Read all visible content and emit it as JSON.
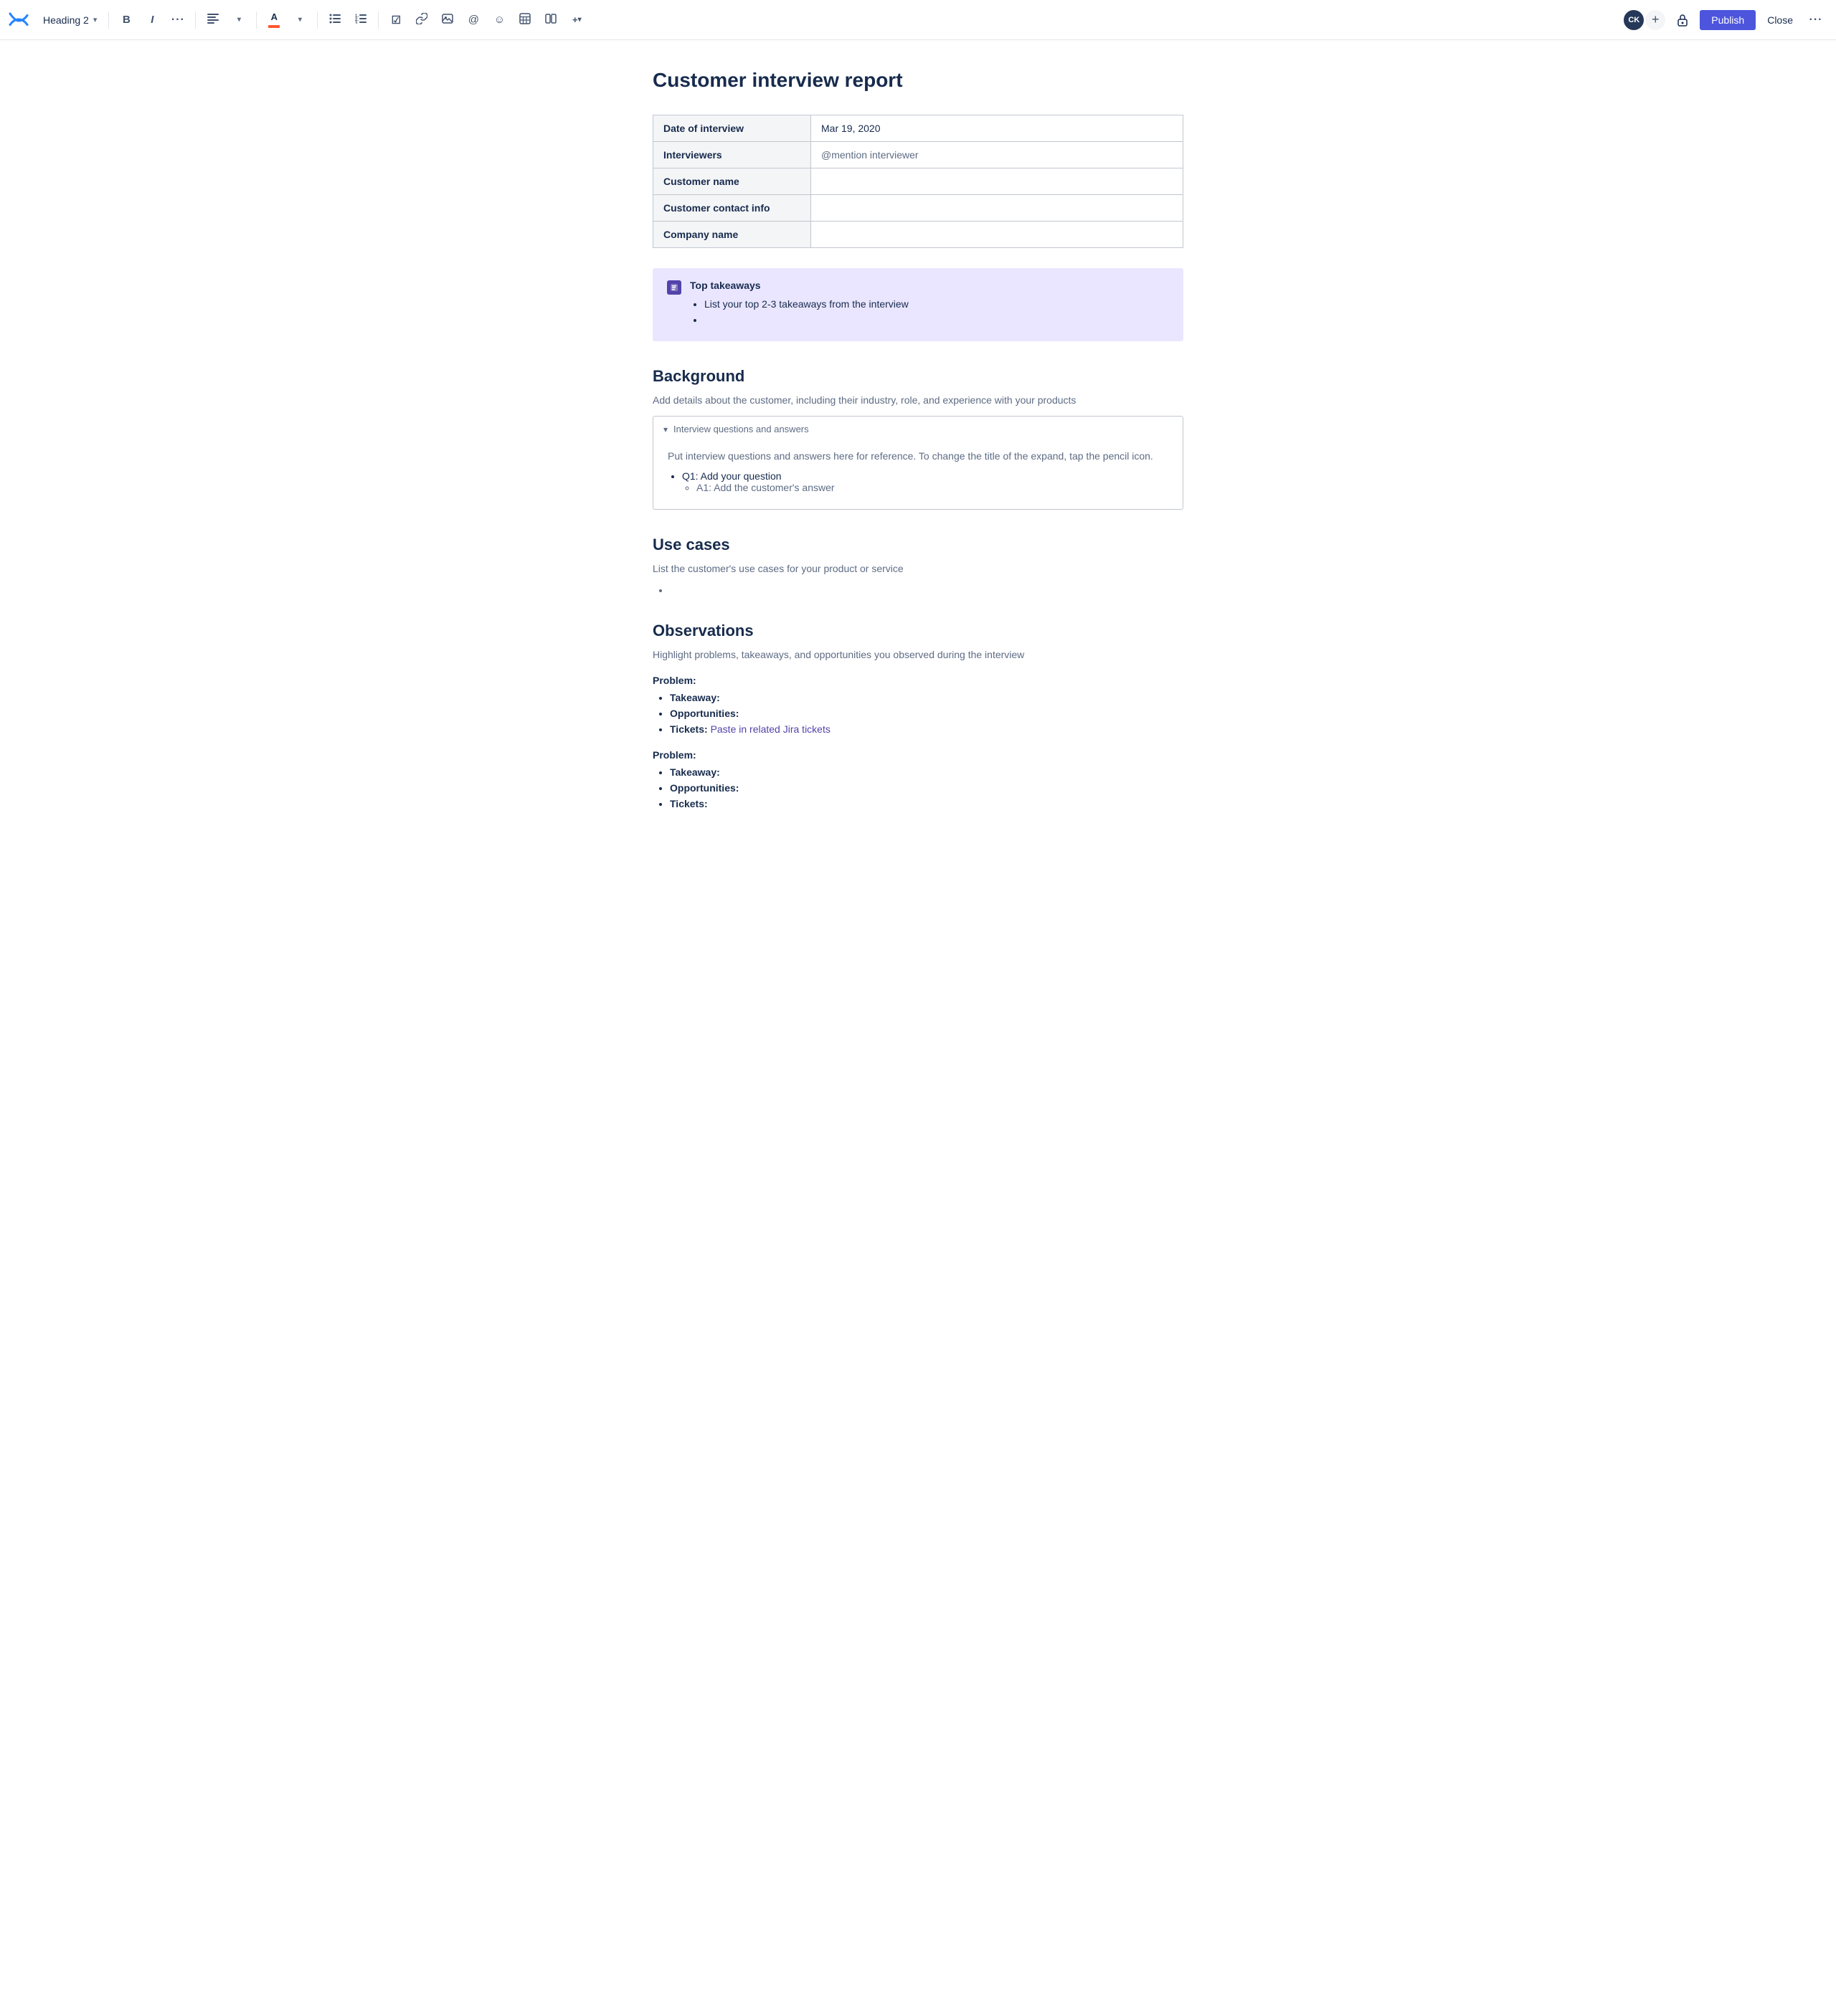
{
  "toolbar": {
    "logo_label": "Confluence",
    "heading_label": "Heading 2",
    "bold_label": "B",
    "italic_label": "I",
    "more_label": "···",
    "align_label": "≡",
    "bullet_list_label": "≡",
    "numbered_list_label": "≡",
    "task_label": "☑",
    "link_label": "🔗",
    "image_label": "🖼",
    "mention_label": "@",
    "emoji_label": "☺",
    "table_label": "▦",
    "layout_label": "⊟",
    "more_insert_label": "+",
    "avatar_initials": "CK",
    "avatar_bg": "#253858",
    "add_label": "+",
    "lock_label": "🔒",
    "publish_label": "Publish",
    "close_label": "Close",
    "more_options_label": "···"
  },
  "document": {
    "title": "Customer interview report",
    "info_table": {
      "rows": [
        {
          "label": "Date of interview",
          "value": "Mar 19, 2020"
        },
        {
          "label": "Interviewers",
          "value": "@mention interviewer"
        },
        {
          "label": "Customer name",
          "value": ""
        },
        {
          "label": "Customer contact info",
          "value": ""
        },
        {
          "label": "Company name",
          "value": ""
        }
      ]
    },
    "callout": {
      "title": "Top takeaways",
      "items": [
        "List your top 2-3 takeaways from the interview",
        ""
      ]
    },
    "sections": [
      {
        "heading": "Background",
        "subtext": "Add details about the customer, including their industry, role, and experience with your products",
        "expand": {
          "title": "Interview questions and answers",
          "body": "Put interview questions and answers here for reference. To change the title of the expand, tap the pencil icon.",
          "items": [
            {
              "text": "Q1: Add your question",
              "subitems": [
                "A1: Add the customer's answer"
              ]
            }
          ]
        }
      },
      {
        "heading": "Use cases",
        "subtext": "List the customer's use cases for your product or service",
        "bullets": [
          ""
        ]
      },
      {
        "heading": "Observations",
        "subtext": "Highlight problems, takeaways, and opportunities you observed during the interview",
        "problems": [
          {
            "label": "Problem:",
            "items": [
              {
                "prefix": "Takeaway:",
                "value": ""
              },
              {
                "prefix": "Opportunities:",
                "value": ""
              },
              {
                "prefix": "Tickets:",
                "value": "Paste in related Jira tickets",
                "link": true
              }
            ]
          },
          {
            "label": "Problem:",
            "items": [
              {
                "prefix": "Takeaway:",
                "value": ""
              },
              {
                "prefix": "Opportunities:",
                "value": ""
              },
              {
                "prefix": "Tickets:",
                "value": ""
              }
            ]
          }
        ]
      }
    ]
  }
}
